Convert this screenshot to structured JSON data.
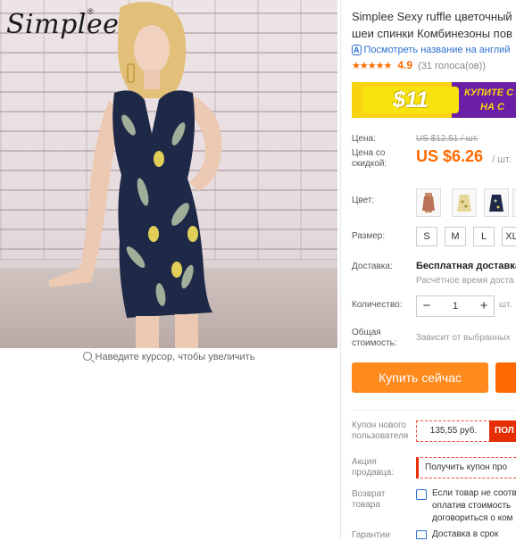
{
  "brand": {
    "name": "Simplee",
    "mark": "®"
  },
  "gallery": {
    "zoom_hint": "Наведите курсор, чтобы увеличить"
  },
  "product": {
    "title_line1": "Simplee Sexy ruffle цветочный",
    "title_line2": "шеи спинки Комбинезоны пов",
    "translate_link": "Посмотреть название на англий",
    "translate_badge": "A",
    "rating_stars": "★★★★★",
    "rating_value": "4.9",
    "rating_count": "(31 голоса(ов))"
  },
  "banner": {
    "price": "$11",
    "cta_line1": "КУПИТЕ С",
    "cta_line2": "НА С"
  },
  "price": {
    "label": "Цена:",
    "old": "US $12.51 / шт.",
    "discount_label_1": "Цена со",
    "discount_label_2": "скидкой:",
    "new": "US $6.26",
    "unit": "/ шт."
  },
  "color": {
    "label": "Цвет:"
  },
  "size": {
    "label": "Размер:",
    "options": [
      "S",
      "M",
      "L",
      "XL"
    ]
  },
  "shipping": {
    "label": "Доставка:",
    "free": "Бесплатная доставка",
    "time": "Расчётное время доста"
  },
  "quantity": {
    "label": "Количество:",
    "value": "1",
    "unit": "шт.",
    "minus": "−",
    "plus": "+"
  },
  "total": {
    "label_1": "Общая",
    "label_2": "стоимость:",
    "note": "Зависит от выбранных"
  },
  "actions": {
    "buy_now": "Купить сейчас"
  },
  "coupon": {
    "label_1": "Купон нового",
    "label_2": "пользователя",
    "amount": "135,55 руб.",
    "get": "ПОЛ"
  },
  "promo": {
    "label_1": "Акция",
    "label_2": "продавца:",
    "text": "Получить купон про"
  },
  "returns": {
    "label_1": "Возврат",
    "label_2": "товара",
    "line1": "Если товар не соотв",
    "line2": "оплатив стоимость",
    "line3": "договориться о ком"
  },
  "guarantee": {
    "label": "Гарантии",
    "text": "Доставка в срок"
  },
  "colors": {
    "accent": "#ff6a00",
    "buy_button": "#ff8a1e",
    "link": "#2d6fd1",
    "coupon_red": "#e62e04",
    "banner_yellow": "#f7d40f",
    "banner_purple": "#6a1fa6"
  }
}
